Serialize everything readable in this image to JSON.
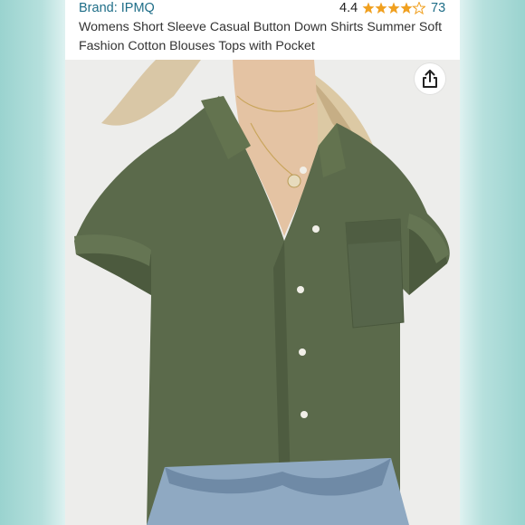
{
  "product": {
    "brand": "Brand: IPMQ",
    "rating": "4.4",
    "rating_stars": 4.4,
    "review_count": "73",
    "title": "Womens Short Sleeve Casual Button Down Shirts Summer Soft Fashion Cotton Blouses Tops with Pocket"
  },
  "colors": {
    "link": "#1f6e88",
    "star": "#f0a020",
    "shirt": "#5b6a4b",
    "background": "#dff2f1"
  },
  "icons": {
    "share": "share-icon",
    "star": "star-icon"
  }
}
